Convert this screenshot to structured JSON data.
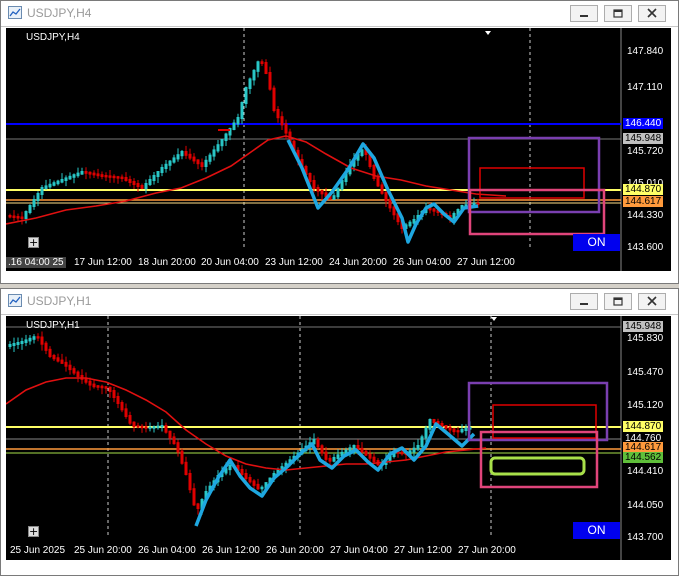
{
  "window1": {
    "title": "USDJPY,H4",
    "symbol_label": "USDJPY,H4",
    "y_ticks": [
      "147.840",
      "147.110",
      "146.440",
      "145.720",
      "145.010",
      "144.330",
      "143.600"
    ],
    "price_tags": {
      "blue": "146.440",
      "current": "145.948",
      "yellow": "144.870",
      "orange": "144.617"
    },
    "x_labels": [
      ".16 04:00 25",
      "17 Jun 12:00",
      "18 Jun 20:00",
      "20 Jun 04:00",
      "23 Jun 12:00",
      "24 Jun 20:00",
      "26 Jun 04:00",
      "27 Jun 12:00"
    ],
    "on_button": "ON"
  },
  "window2": {
    "title": "USDJPY,H1",
    "symbol_label": "USDJPY,H1",
    "y_ticks": [
      "145.830",
      "145.470",
      "145.120",
      "144.410",
      "144.050",
      "143.700"
    ],
    "price_tags": {
      "current": "145.948",
      "yellow": "144.870",
      "mid1": "144.760",
      "mid2": "144.617",
      "green": "144.562"
    },
    "x_labels": [
      "25 Jun 2025",
      "25 Jun 20:00",
      "26 Jun 04:00",
      "26 Jun 12:00",
      "26 Jun 20:00",
      "27 Jun 04:00",
      "27 Jun 12:00",
      "27 Jun 20:00"
    ],
    "on_button": "ON"
  },
  "colors": {
    "bull": "#29c7c7",
    "bear": "#e00000",
    "ma": "#e01010",
    "wave": "#1ea7e0",
    "yellow_line": "#ffff66",
    "orange_line": "#ff9a3c",
    "blue_line": "#0000ff",
    "purple_box": "#7a3fb0",
    "pink_box": "#e0457b",
    "red_box": "#e00000",
    "green_box": "#a8e04a"
  }
}
